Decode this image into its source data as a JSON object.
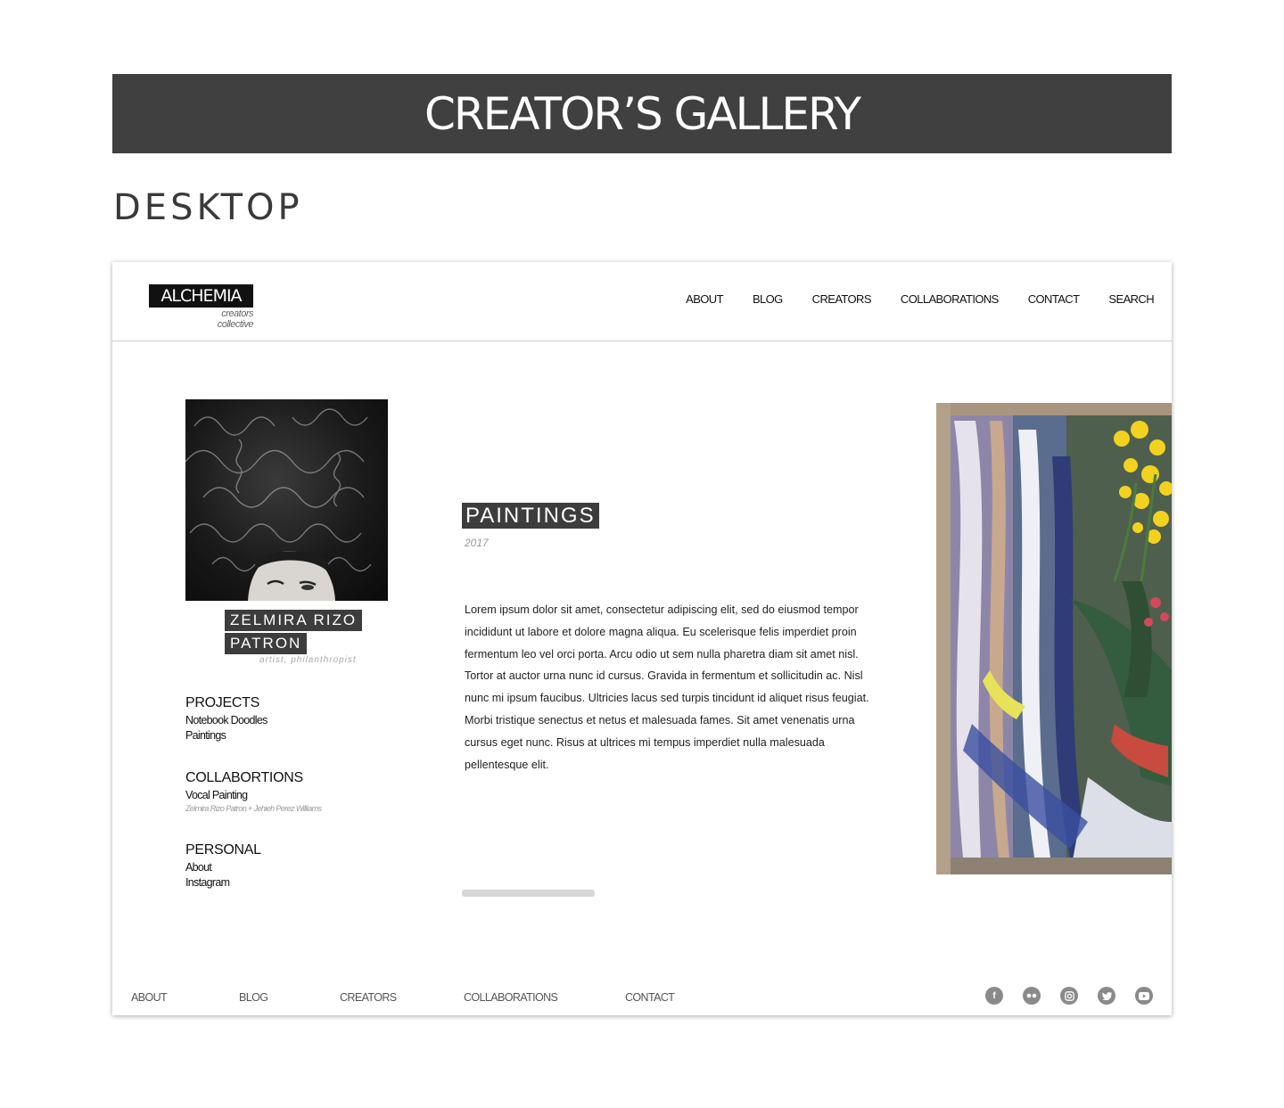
{
  "banner": {
    "title": "CREATOR’S GALLERY"
  },
  "section_label": "DESKTOP",
  "site": {
    "logo": "ALCHEMIA",
    "tagline": "creators collective",
    "nav": [
      "ABOUT",
      "BLOG",
      "CREATORS",
      "COLLABORATIONS",
      "CONTACT",
      "SEARCH"
    ]
  },
  "profile": {
    "name_line1": "ZELMIRA RIZO",
    "name_line2": "PATRON",
    "role": "artist, philanthropist"
  },
  "sidebar": {
    "projects_heading": "PROJECTS",
    "projects": [
      "Notebook Doodles",
      "Paintings"
    ],
    "collab_heading": "COLLABORTIONS",
    "collabs": [
      "Vocal Painting"
    ],
    "collab_credit": "Zelmira Rizo Patron + Jehieh Perez Williams",
    "personal_heading": "PERSONAL",
    "personal": [
      "About",
      "Instagram"
    ]
  },
  "project": {
    "title": "PAINTINGS",
    "year": "2017",
    "body": "Lorem ipsum dolor sit amet, consectetur adipiscing elit, sed do eiusmod tempor incididunt ut labore et dolore magna aliqua. Eu scelerisque felis imperdiet proin fermentum leo vel orci porta. Arcu odio ut sem nulla pharetra diam sit amet nisl. Tortor at auctor urna nunc id cursus. Gravida in fermentum et sollicitudin ac. Nisl nunc mi ipsum faucibus. Ultricies lacus sed turpis tincidunt id aliquet risus feugiat. Morbi tristique senectus et netus et malesuada fames. Sit amet venenatis urna cursus eget nunc. Risus at ultrices mi tempus imperdiet nulla malesuada pellentesque elit."
  },
  "footer": {
    "nav": [
      "ABOUT",
      "BLOG",
      "CREATORS",
      "COLLABORATIONS",
      "CONTACT"
    ],
    "social_icons": [
      "facebook-icon",
      "flickr-icon",
      "instagram-icon",
      "twitter-icon",
      "youtube-icon"
    ]
  },
  "colors": {
    "banner": "#404040",
    "tag": "#3d3d3d",
    "logo": "#111111",
    "social": "#8a8a8a"
  }
}
